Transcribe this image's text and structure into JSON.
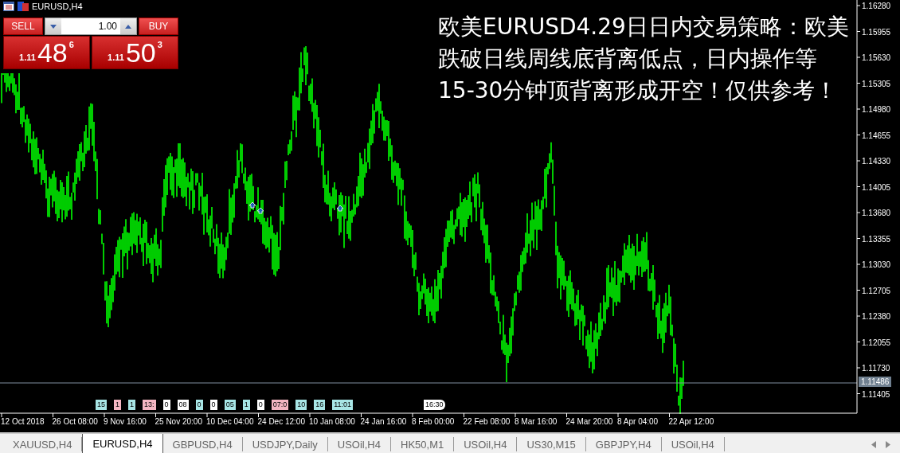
{
  "window": {
    "title": "EURUSD,H4"
  },
  "trade_panel": {
    "sell_label": "SELL",
    "buy_label": "BUY",
    "volume": "1.00",
    "sell_price": {
      "prefix": "1.11",
      "big": "48",
      "sup": "6"
    },
    "buy_price": {
      "prefix": "1.11",
      "big": "50",
      "sup": "3"
    }
  },
  "headline": "欧美EURUSD4.29日日内交易策略：欧美跌破日线周线底背离低点，日内操作等15-30分钟顶背离形成开空！仅供参考！",
  "price_axis": {
    "ticks": [
      "1.16280",
      "1.15955",
      "1.15630",
      "1.15305",
      "1.14980",
      "1.14655",
      "1.14330",
      "1.14005",
      "1.13680",
      "1.13355",
      "1.13030",
      "1.12705",
      "1.12380",
      "1.12055",
      "1.11730",
      "1.11405"
    ],
    "current_price": "1.11486"
  },
  "time_axis": {
    "labels": [
      "12 Oct 2018",
      "26 Oct 08:00",
      "9 Nov 16:00",
      "25 Nov 20:00",
      "10 Dec 04:00",
      "24 Dec 12:00",
      "10 Jan 08:00",
      "24 Jan 16:00",
      "8 Feb 00:00",
      "22 Feb 08:00",
      "8 Mar 16:00",
      "24 Mar 20:00",
      "8 Apr 04:00",
      "22 Apr 12:00"
    ]
  },
  "event_tags": [
    {
      "text": "15",
      "color": "#a8e6e6"
    },
    {
      "text": "1",
      "color": "#f4b6c2"
    },
    {
      "text": "1",
      "color": "#a8e6e6"
    },
    {
      "text": "13:",
      "color": "#f4b6c2"
    },
    {
      "text": "0",
      "color": "#ffffff"
    },
    {
      "text": "08",
      "color": "#ffffff"
    },
    {
      "text": "0",
      "color": "#a8e6e6"
    },
    {
      "text": "0",
      "color": "#ffffff"
    },
    {
      "text": "05",
      "color": "#a8e6e6"
    },
    {
      "text": "1",
      "color": "#a8e6e6"
    },
    {
      "text": "0",
      "color": "#ffffff"
    },
    {
      "text": "07:0",
      "color": "#f4b6c2"
    },
    {
      "text": "10",
      "color": "#a8e6e6"
    },
    {
      "text": "16",
      "color": "#a8e6e6"
    },
    {
      "text": "11:01",
      "color": "#a8e6e6"
    },
    {
      "text": "16:30",
      "color": "#ffffff"
    }
  ],
  "tabs": [
    {
      "label": "XAUUSD,H4",
      "selected": false
    },
    {
      "label": "EURUSD,H4",
      "selected": true
    },
    {
      "label": "GBPUSD,H4",
      "selected": false
    },
    {
      "label": "USDJPY,Daily",
      "selected": false
    },
    {
      "label": "USOil,H4",
      "selected": false
    },
    {
      "label": "HK50,M1",
      "selected": false
    },
    {
      "label": "USOil,H4",
      "selected": false
    },
    {
      "label": "US30,M15",
      "selected": false
    },
    {
      "label": "GBPJPY,H4",
      "selected": false
    },
    {
      "label": "USOil,H4",
      "selected": false
    }
  ]
}
